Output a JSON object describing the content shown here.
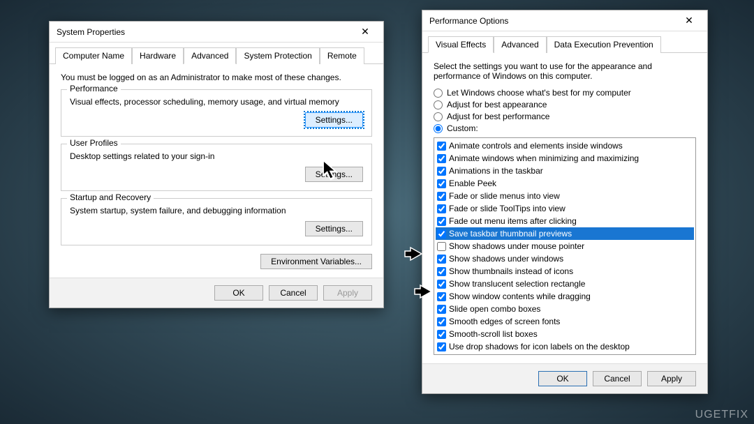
{
  "sysprops": {
    "title": "System Properties",
    "tabs": [
      "Computer Name",
      "Hardware",
      "Advanced",
      "System Protection",
      "Remote"
    ],
    "active_tab": 2,
    "intro": "You must be logged on as an Administrator to make most of these changes.",
    "groups": {
      "performance": {
        "legend": "Performance",
        "desc": "Visual effects, processor scheduling, memory usage, and virtual memory",
        "btn": "Settings..."
      },
      "userprofiles": {
        "legend": "User Profiles",
        "desc": "Desktop settings related to your sign-in",
        "btn": "Settings..."
      },
      "startup": {
        "legend": "Startup and Recovery",
        "desc": "System startup, system failure, and debugging information",
        "btn": "Settings..."
      }
    },
    "envvars_btn": "Environment Variables...",
    "ok": "OK",
    "cancel": "Cancel",
    "apply": "Apply"
  },
  "perfopts": {
    "title": "Performance Options",
    "tabs": [
      "Visual Effects",
      "Advanced",
      "Data Execution Prevention"
    ],
    "active_tab": 0,
    "intro": "Select the settings you want to use for the appearance and performance of Windows on this computer.",
    "radios": {
      "let": "Let Windows choose what's best for my computer",
      "best_appearance": "Adjust for best appearance",
      "best_performance": "Adjust for best performance",
      "custom": "Custom:"
    },
    "selected_radio": "custom",
    "items": [
      {
        "label": "Animate controls and elements inside windows",
        "checked": true
      },
      {
        "label": "Animate windows when minimizing and maximizing",
        "checked": true
      },
      {
        "label": "Animations in the taskbar",
        "checked": true
      },
      {
        "label": "Enable Peek",
        "checked": true
      },
      {
        "label": "Fade or slide menus into view",
        "checked": true
      },
      {
        "label": "Fade or slide ToolTips into view",
        "checked": true
      },
      {
        "label": "Fade out menu items after clicking",
        "checked": true
      },
      {
        "label": "Save taskbar thumbnail previews",
        "checked": true,
        "selected": true
      },
      {
        "label": "Show shadows under mouse pointer",
        "checked": false
      },
      {
        "label": "Show shadows under windows",
        "checked": true
      },
      {
        "label": "Show thumbnails instead of icons",
        "checked": true
      },
      {
        "label": "Show translucent selection rectangle",
        "checked": true
      },
      {
        "label": "Show window contents while dragging",
        "checked": true
      },
      {
        "label": "Slide open combo boxes",
        "checked": true
      },
      {
        "label": "Smooth edges of screen fonts",
        "checked": true
      },
      {
        "label": "Smooth-scroll list boxes",
        "checked": true
      },
      {
        "label": "Use drop shadows for icon labels on the desktop",
        "checked": true
      }
    ],
    "ok": "OK",
    "cancel": "Cancel",
    "apply": "Apply"
  },
  "watermark": "UGETFIX"
}
